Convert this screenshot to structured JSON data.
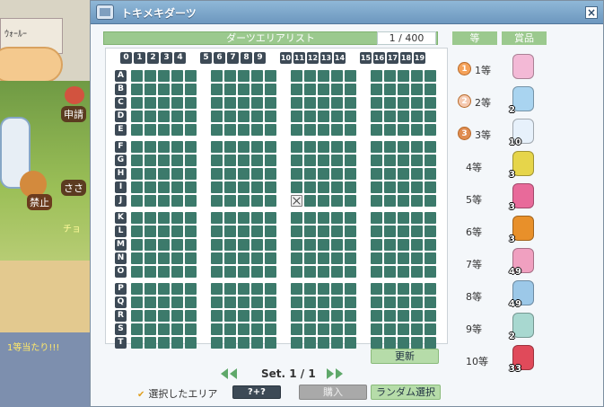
{
  "scene": {
    "sign_text": "ｳｫｰﾙｰ",
    "tag_apply": "申請",
    "tag_forbid": "禁止",
    "tag_name": "ささ",
    "chat": "チョ",
    "win_text": "1等当たり!!!"
  },
  "window": {
    "title": "トキメキダーツ",
    "close_label": "×",
    "list_title": "ダーツエリアリスト",
    "count": "1 / 400",
    "rank_header": "等",
    "prize_header": "賞品"
  },
  "board": {
    "col_groups": [
      [
        "0",
        "1",
        "2",
        "3",
        "4"
      ],
      [
        "5",
        "6",
        "7",
        "8",
        "9"
      ],
      [
        "10",
        "11",
        "12",
        "13",
        "14"
      ],
      [
        "15",
        "16",
        "17",
        "18",
        "19"
      ]
    ],
    "row_groups": [
      [
        "A",
        "B",
        "C",
        "D",
        "E"
      ],
      [
        "F",
        "G",
        "H",
        "I",
        "J"
      ],
      [
        "K",
        "L",
        "M",
        "N",
        "O"
      ],
      [
        "P",
        "Q",
        "R",
        "S",
        "T"
      ]
    ],
    "selected_cell": {
      "row": "J",
      "col": "10"
    }
  },
  "prizes": [
    {
      "rank": "1等",
      "medal": "1",
      "qty": "",
      "icon": "pink-box-icon",
      "color": "#f3b9d6",
      "medal_color": "#f5a25a"
    },
    {
      "rank": "2等",
      "medal": "2",
      "qty": "2",
      "icon": "blue-wings-icon",
      "color": "#a9d4f0",
      "medal_color": "#f5c9b0"
    },
    {
      "rank": "3等",
      "medal": "3",
      "qty": "10",
      "icon": "feather-icon",
      "color": "#e7f1fb",
      "medal_color": "#e08c50"
    },
    {
      "rank": "4等",
      "medal": "",
      "qty": "3",
      "icon": "yellow-can-icon",
      "color": "#e6d54a"
    },
    {
      "rank": "5等",
      "medal": "",
      "qty": "3",
      "icon": "pink-can-icon",
      "color": "#e86a9a"
    },
    {
      "rank": "6等",
      "medal": "",
      "qty": "3",
      "icon": "orange-can-icon",
      "color": "#e8902a"
    },
    {
      "rank": "7等",
      "medal": "",
      "qty": "49",
      "icon": "pink-potion-icon",
      "color": "#f0a0c0"
    },
    {
      "rank": "8等",
      "medal": "",
      "qty": "49",
      "icon": "blue-potion-icon",
      "color": "#9cc8e8"
    },
    {
      "rank": "9等",
      "medal": "",
      "qty": "2",
      "icon": "sphere-icon",
      "color": "#a8d8d0"
    },
    {
      "rank": "10等",
      "medal": "",
      "qty": "33",
      "icon": "red-funnel-icon",
      "color": "#e04a5a"
    }
  ],
  "controls": {
    "update_label": "更新",
    "set_label": "Set. 1 / 1",
    "legend_label": "選択したエリア",
    "help_label": "?+?",
    "buy_label": "購入",
    "random_label": "ランダム選択"
  }
}
